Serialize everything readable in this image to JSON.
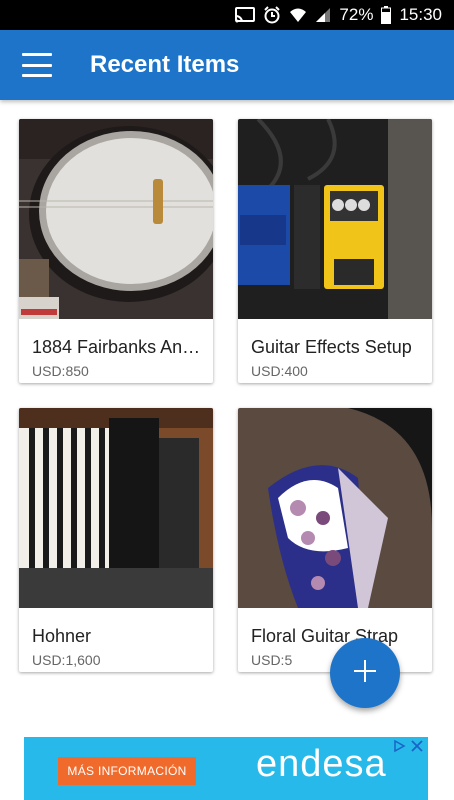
{
  "status_bar": {
    "battery": "72%",
    "time": "15:30"
  },
  "app_bar": {
    "title": "Recent Items",
    "menu_icon": "hamburger-menu-icon"
  },
  "items": [
    {
      "title": "1884 Fairbanks An…",
      "price": "USD:850",
      "image": "banjo-photo"
    },
    {
      "title": "Guitar Effects Setup",
      "price": "USD:400",
      "image": "guitar-pedals-photo"
    },
    {
      "title": "Hohner",
      "price": "USD:1,600",
      "image": "accordion-photo"
    },
    {
      "title": "Floral Guitar Strap",
      "price": "USD:5",
      "image": "floral-strap-photo"
    }
  ],
  "fab": {
    "icon": "plus-icon",
    "color": "#1d74c9"
  },
  "ad": {
    "button_label": "MÁS INFORMACIÓN",
    "brand": "endesa",
    "icons": [
      "adchoices-icon",
      "close-icon"
    ]
  },
  "colors": {
    "primary": "#1d74c9",
    "ad_background": "#26b9e9",
    "ad_button": "#f06a2b"
  }
}
